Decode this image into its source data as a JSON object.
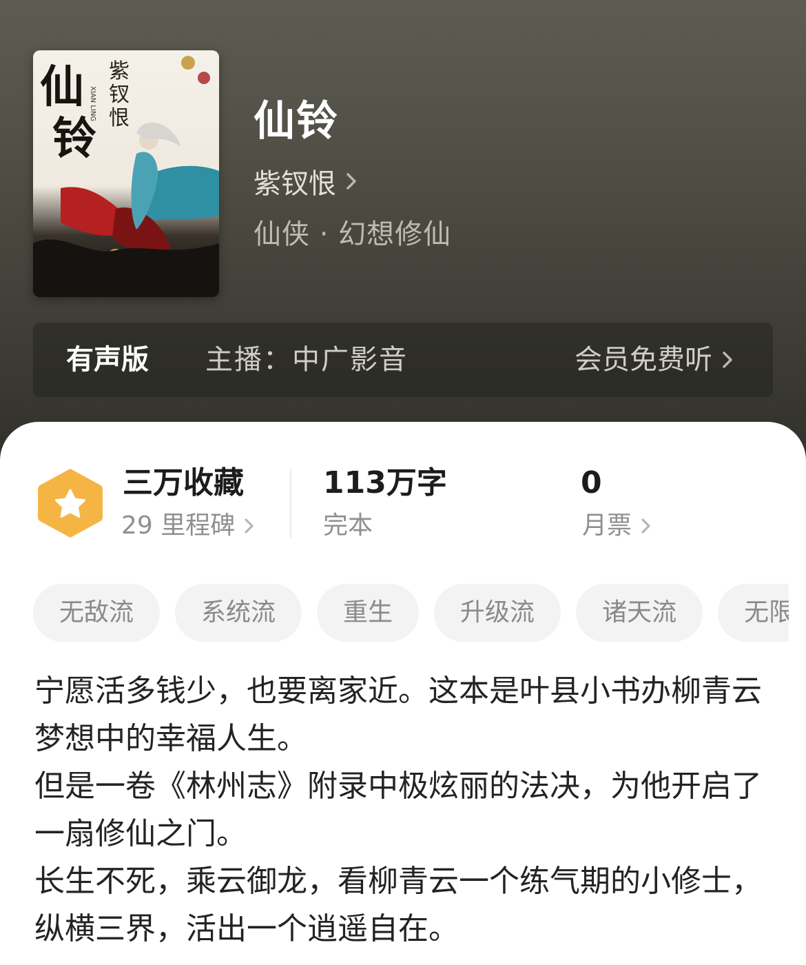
{
  "book": {
    "title": "仙铃",
    "author": "紫钗恨",
    "genre": "仙侠 · 幻想修仙",
    "cover": {
      "title_chars": "仙铃",
      "author_text": "紫钗恨",
      "pinyin": "XIAN LING"
    }
  },
  "audio": {
    "label": "有声版",
    "host": "主播：中广影音",
    "cta": "会员免费听"
  },
  "stats": {
    "collect": {
      "value": "三万收藏",
      "sub": "29 里程碑"
    },
    "words": {
      "value": "113万字",
      "sub": "完本"
    },
    "tickets": {
      "value": "0",
      "sub": "月票"
    }
  },
  "tags": [
    "无敌流",
    "系统流",
    "重生",
    "升级流",
    "诸天流",
    "无限"
  ],
  "description": [
    "宁愿活多钱少，也要离家近。这本是叶县小书办柳青云梦想中的幸福人生。",
    "但是一卷《林州志》附录中极炫丽的法决，为他开启了一扇修仙之门。",
    "长生不死，乘云御龙，看柳青云一个练气期的小修士，纵横三界，活出一个逍遥自在。"
  ],
  "colors": {
    "badge": "#f5b544",
    "hero_bg": "#4f4e45"
  },
  "icons": [
    "chevron-right-icon",
    "star-badge-icon"
  ]
}
